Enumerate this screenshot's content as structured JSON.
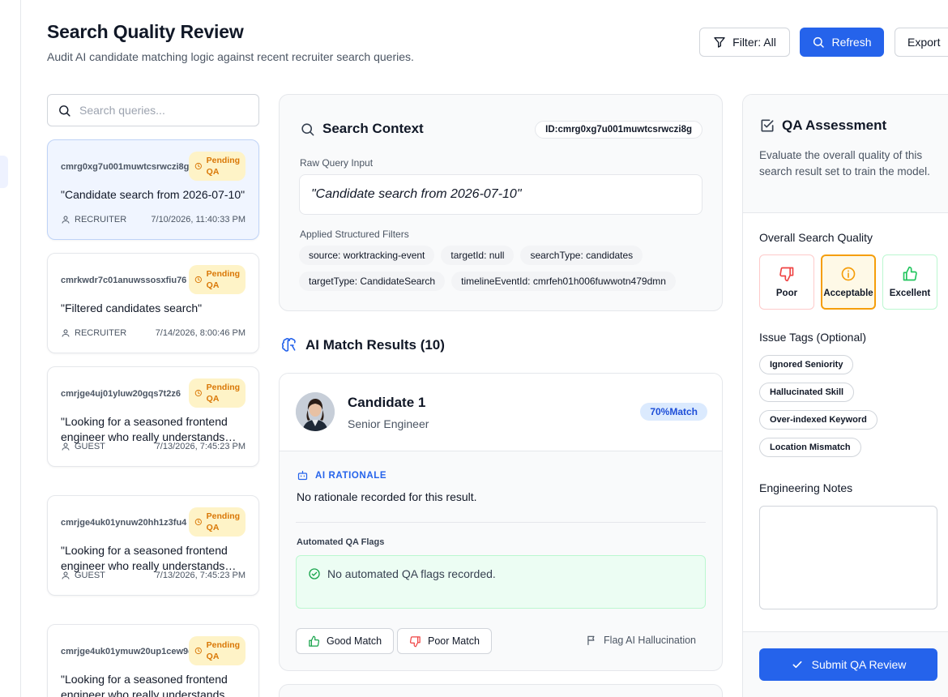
{
  "header": {
    "title": "Search Quality Review",
    "subtitle": "Audit AI candidate matching logic against recent recruiter search queries.",
    "filter_label": "Filter: All",
    "refresh_label": "Refresh",
    "export_label": "Export"
  },
  "search": {
    "placeholder": "Search queries..."
  },
  "queries": [
    {
      "id": "cmrg0xg7u001muwtcsrwczi8g",
      "status": "Pending QA",
      "text": "\"Candidate search from 2026-07-10\"",
      "role": "RECRUITER",
      "timestamp": "7/10/2026, 11:40:33 PM"
    },
    {
      "id": "cmrkwdr7c01anuwssosxfiu76",
      "status": "Pending QA",
      "text": "\"Filtered candidates search\"",
      "role": "RECRUITER",
      "timestamp": "7/14/2026, 8:00:46 PM"
    },
    {
      "id": "cmrjge4uj01yluw20gqs7t2z6",
      "status": "Pending QA",
      "text": "\"Looking for a seasoned frontend engineer who really understands performance\"",
      "role": "GUEST",
      "timestamp": "7/13/2026, 7:45:23 PM"
    },
    {
      "id": "cmrjge4uk01ynuw20hh1z3fu4",
      "status": "Pending QA",
      "text": "\"Looking for a seasoned frontend engineer who really understands performance\"",
      "role": "GUEST",
      "timestamp": "7/13/2026, 7:45:23 PM"
    },
    {
      "id": "cmrjge4uk01ymuw20up1cew9c",
      "status": "Pending QA",
      "text": "\"Looking for a seasoned frontend engineer who really understands performance\"",
      "role": "GUEST",
      "timestamp": "7/13/2026, 7:45:23 PM"
    }
  ],
  "context": {
    "title": "Search Context",
    "id_badge": "ID:cmrg0xg7u001muwtcsrwczi8g",
    "raw_label": "Raw Query Input",
    "raw_query": "\"Candidate search from 2026-07-10\"",
    "filters_label": "Applied Structured Filters",
    "filters": [
      "source: worktracking-event",
      "targetId: null",
      "searchType: candidates",
      "targetType: CandidateSearch",
      "timelineEventId: cmrfeh01h006fuwwotn479dmn"
    ]
  },
  "results": {
    "title": "AI Match Results (10)",
    "candidate": {
      "name": "Candidate 1",
      "role": "Senior Engineer",
      "match": "70%Match",
      "ai_label": "AI RATIONALE",
      "rationale": "No rationale recorded for this result.",
      "flags_label": "Automated QA Flags",
      "flags_text": "No automated QA flags recorded.",
      "good_label": "Good Match",
      "poor_label": "Poor Match",
      "flag_label": "Flag AI Hallucination"
    }
  },
  "qa": {
    "title": "QA Assessment",
    "description": "Evaluate the overall quality of this search result set to train the model.",
    "quality_label": "Overall Search Quality",
    "ratings": {
      "poor": "Poor",
      "acceptable": "Acceptable",
      "excellent": "Excellent"
    },
    "selected_rating": "Acceptable",
    "tags_label": "Issue Tags (Optional)",
    "tags": [
      "Ignored Seniority",
      "Hallucinated Skill",
      "Over-indexed Keyword",
      "Location Mismatch"
    ],
    "notes_label": "Engineering Notes",
    "notes_value": "",
    "submit_label": "Submit QA Review"
  },
  "colors": {
    "primary": "#2563eb",
    "pending_bg": "#fef3c7",
    "pending_text": "#d97706",
    "success_bg": "#ecfdf3",
    "danger": "#ef4444",
    "success": "#22c55e",
    "warning": "#f59e0b"
  }
}
